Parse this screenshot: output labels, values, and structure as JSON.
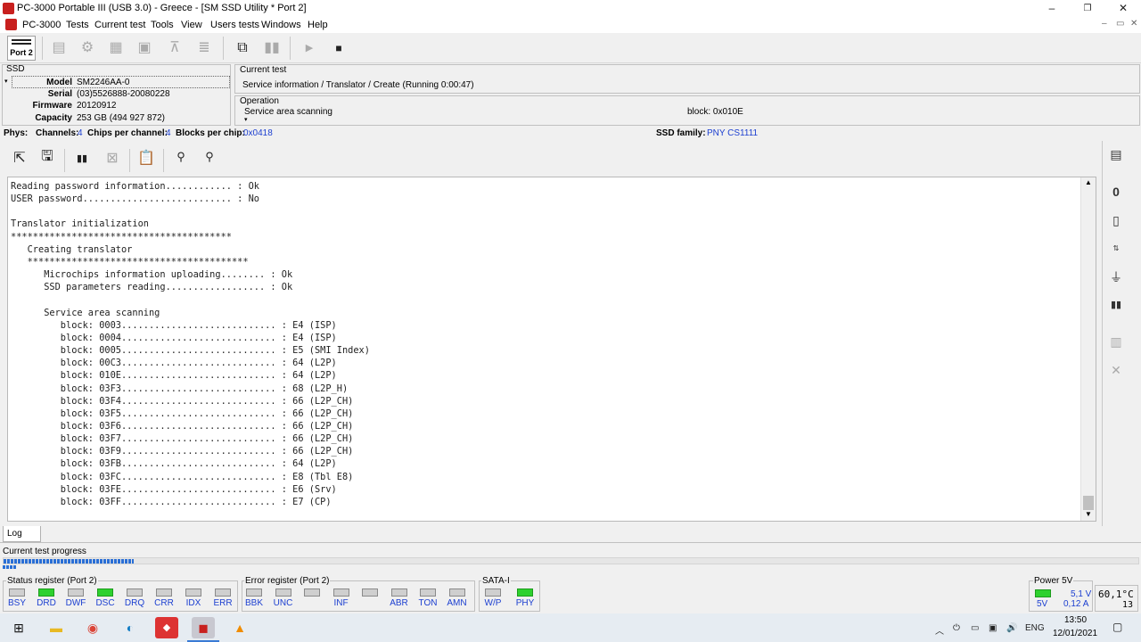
{
  "window": {
    "title": "PC-3000 Portable III (USB 3.0) - Greece - [SM SSD Utility * Port 2]",
    "minimize": "–",
    "maximize": "❐",
    "close": "✕"
  },
  "menu": [
    "PC-3000",
    "Tests",
    "Current test",
    "Tools",
    "View",
    "Users tests",
    "Windows",
    "Help"
  ],
  "mdi_controls": [
    "–",
    "▭",
    "✕"
  ],
  "toolbar": {
    "port_label": "Port 2"
  },
  "ssd": {
    "group_label": "SSD",
    "model_label": "Model",
    "model": "SM2246AA-0",
    "serial_label": "Serial",
    "serial": "(03)5526888-20080228",
    "firmware_label": "Firmware",
    "firmware": "20120912",
    "capacity_label": "Capacity",
    "capacity": "253 GB (494 927 872)"
  },
  "current_test": {
    "label": "Current test",
    "value": "Service information / Translator / Create (Running 0:00:47)"
  },
  "operation": {
    "label": "Operation",
    "value": "Service area scanning",
    "block": "block: 0x010E"
  },
  "phys": {
    "label": "Phys:",
    "channels_label": "Channels:",
    "channels": "4",
    "chips_label": "Chips per channel:",
    "chips": "4",
    "blocks_label": "Blocks per chip:",
    "blocks": "0x0418",
    "family_label": "SSD family:",
    "family": "PNY CS1111"
  },
  "log": {
    "tab_label": "Log",
    "lines": [
      "Reading password information............ : Ok",
      "USER password........................... : No",
      "",
      "Translator initialization",
      "****************************************",
      "   Creating translator",
      "   ****************************************",
      "      Microchips information uploading........ : Ok",
      "      SSD parameters reading.................. : Ok",
      "",
      "      Service area scanning",
      "         block: 0003............................ : E4 (ISP)",
      "         block: 0004............................ : E4 (ISP)",
      "         block: 0005............................ : E5 (SMI Index)",
      "         block: 00C3............................ : 64 (L2P)",
      "         block: 010E............................ : 64 (L2P)",
      "         block: 03F3............................ : 68 (L2P_H)",
      "         block: 03F4............................ : 66 (L2P_CH)",
      "         block: 03F5............................ : 66 (L2P_CH)",
      "         block: 03F6............................ : 66 (L2P_CH)",
      "         block: 03F7............................ : 66 (L2P_CH)",
      "         block: 03F9............................ : 66 (L2P_CH)",
      "         block: 03FB............................ : 64 (L2P)",
      "         block: 03FC............................ : E8 (Tbl E8)",
      "         block: 03FE............................ : E6 (Srv)",
      "         block: 03FF............................ : E7 (CP)"
    ]
  },
  "progress": {
    "label": "Current test progress",
    "fraction": 0.115
  },
  "status_register": {
    "label": "Status register (Port 2)",
    "leds": [
      {
        "name": "BSY",
        "on": false
      },
      {
        "name": "DRD",
        "on": true
      },
      {
        "name": "DWF",
        "on": false
      },
      {
        "name": "DSC",
        "on": true
      },
      {
        "name": "DRQ",
        "on": false
      },
      {
        "name": "CRR",
        "on": false
      },
      {
        "name": "IDX",
        "on": false
      },
      {
        "name": "ERR",
        "on": false
      }
    ]
  },
  "error_register": {
    "label": "Error register (Port 2)",
    "leds": [
      {
        "name": "BBK",
        "on": false
      },
      {
        "name": "UNC",
        "on": false
      },
      {
        "name": "",
        "on": false
      },
      {
        "name": "INF",
        "on": false
      },
      {
        "name": "",
        "on": false
      },
      {
        "name": "ABR",
        "on": false
      },
      {
        "name": "TON",
        "on": false
      },
      {
        "name": "AMN",
        "on": false
      }
    ]
  },
  "sata": {
    "label": "SATA-I",
    "leds": [
      {
        "name": "W/P",
        "on": false
      },
      {
        "name": "PHY",
        "on": true
      }
    ]
  },
  "power": {
    "label": "Power 5V",
    "led_label": "5V",
    "voltage": "5,1 V",
    "current": "0,12 A",
    "temperature": "60,1°C",
    "temp_sub": "13"
  },
  "taskbar": {
    "language": "ENG",
    "time": "13:50",
    "date": "12/01/2021"
  },
  "colors": {
    "led_on": "#2ed12e",
    "value_blue": "#1c3fd0",
    "progress": "#2a6fd6"
  }
}
